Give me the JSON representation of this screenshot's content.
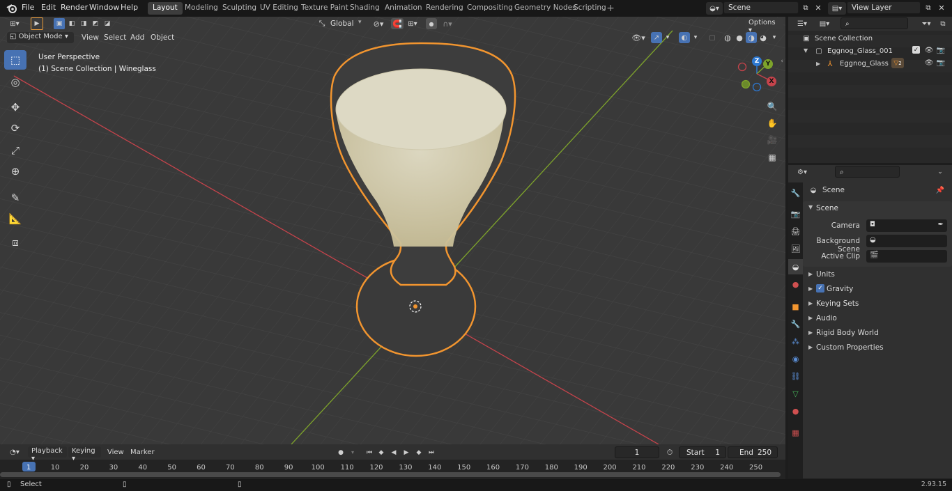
{
  "topbar": {
    "menus": [
      "File",
      "Edit",
      "Render",
      "Window",
      "Help"
    ],
    "workspaces": [
      "Layout",
      "Modeling",
      "Sculpting",
      "UV Editing",
      "Texture Paint",
      "Shading",
      "Animation",
      "Rendering",
      "Compositing",
      "Geometry Nodes",
      "Scripting"
    ],
    "active_workspace": "Layout",
    "scene_name": "Scene",
    "view_layer": "View Layer"
  },
  "viewport_header": {
    "mode": "Object Mode",
    "menus": [
      "View",
      "Select",
      "Add",
      "Object"
    ],
    "orientation": "Global",
    "options_label": "Options"
  },
  "viewport_overlay": {
    "perspective": "User Perspective",
    "collection_info": "(1) Scene Collection | Wineglass"
  },
  "gizmo": {
    "x_label": "X",
    "y_label": "Y",
    "z_label": "Z"
  },
  "outliner": {
    "root": "Scene Collection",
    "items": [
      {
        "label": "Eggnog_Glass_001"
      },
      {
        "label": "Eggnog_Glass"
      }
    ],
    "material_count": "2"
  },
  "properties": {
    "context_title": "Scene",
    "section_title": "Scene",
    "fields": [
      {
        "label": "Camera"
      },
      {
        "label": "Background Scene"
      },
      {
        "label": "Active Clip"
      }
    ],
    "panels": [
      "Units",
      "Gravity",
      "Keying Sets",
      "Audio",
      "Rigid Body World",
      "Custom Properties"
    ]
  },
  "timeline": {
    "menus": [
      "Playback",
      "Keying",
      "View",
      "Marker"
    ],
    "current_frame": "1",
    "start_label": "Start",
    "start_value": "1",
    "end_label": "End",
    "end_value": "250",
    "ruler": [
      "1",
      "10",
      "20",
      "30",
      "40",
      "50",
      "60",
      "70",
      "80",
      "90",
      "100",
      "110",
      "120",
      "130",
      "140",
      "150",
      "160",
      "170",
      "180",
      "190",
      "200",
      "210",
      "220",
      "230",
      "240",
      "250"
    ]
  },
  "statusbar": {
    "hint": "Select",
    "version": "2.93.15"
  },
  "colors": {
    "accent": "#4772b3",
    "selection_outline": "#f2952f",
    "axis_x": "#c5434b",
    "axis_y": "#7ea42b"
  }
}
